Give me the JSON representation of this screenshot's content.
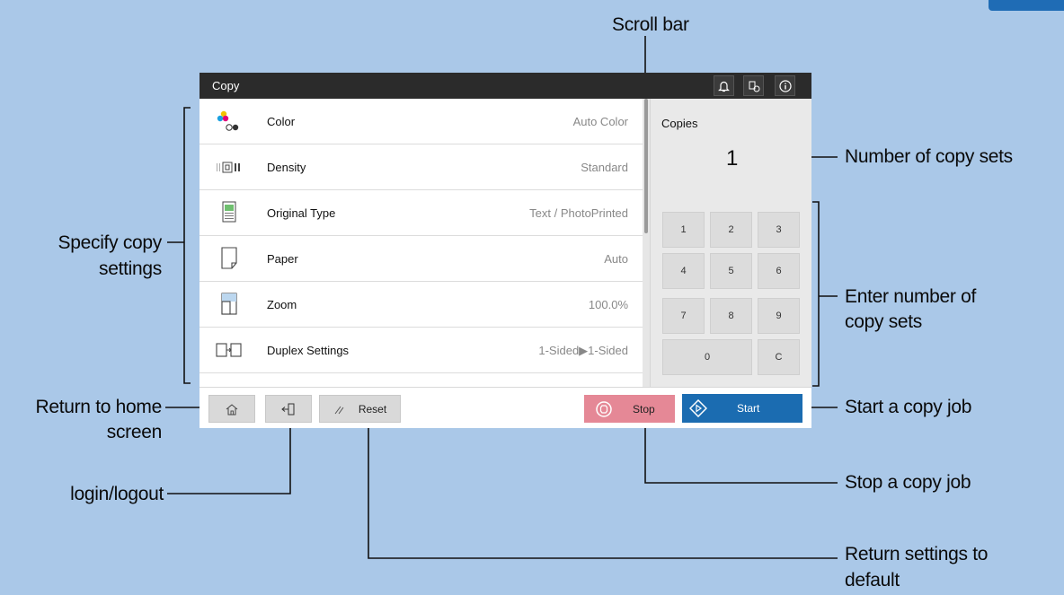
{
  "colors": {
    "background": "#aac8e8",
    "start": "#1b6cb1",
    "stop": "#e58896",
    "titlebar": "#2b2b2b"
  },
  "screen": {
    "title": "Copy",
    "header_icons": [
      "bell-icon",
      "job-status-icon",
      "info-icon"
    ],
    "settings": [
      {
        "label": "Color",
        "value": "Auto  Color",
        "icon": "color-icon"
      },
      {
        "label": "Density",
        "value": "Standard",
        "icon": "density-icon"
      },
      {
        "label": "Original  Type",
        "value": "Text  /  PhotoPrinted",
        "icon": "original-type-icon"
      },
      {
        "label": "Paper",
        "value": "Auto",
        "icon": "paper-icon"
      },
      {
        "label": "Zoom",
        "value": "100.0%",
        "icon": "zoom-icon"
      },
      {
        "label": "Duplex  Settings",
        "value": "1-Sided▶1-Sided",
        "icon": "duplex-icon"
      }
    ],
    "copies_label": "Copies",
    "copies_value": "1",
    "keypad": [
      "1",
      "2",
      "3",
      "4",
      "5",
      "6",
      "7",
      "8",
      "9",
      "0",
      "C"
    ],
    "bottom": {
      "reset": "Reset",
      "stop": "Stop",
      "start": "Start"
    }
  },
  "callouts": {
    "scroll_bar": "Scroll bar",
    "number_of_copy_sets": "Number of copy sets",
    "enter_number_line1": "Enter number of",
    "enter_number_line2": "copy sets",
    "start_job": "Start a copy job",
    "stop_job": "Stop a copy job",
    "return_settings_line1": "Return settings to",
    "return_settings_line2": "default",
    "specify_line1": "Specify copy",
    "specify_line2": "settings",
    "return_home_line1": "Return to home",
    "return_home_line2": "screen",
    "login_logout": "login/logout"
  }
}
